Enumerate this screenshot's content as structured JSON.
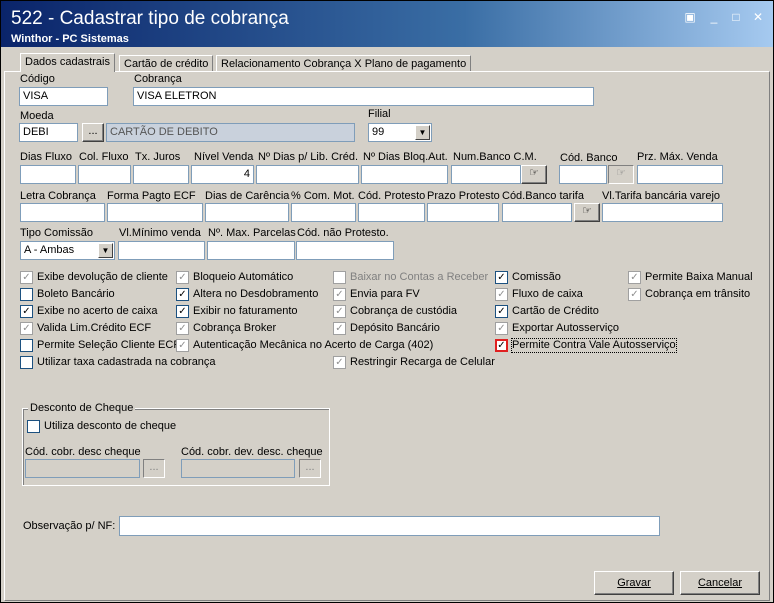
{
  "window": {
    "title": "522 - Cadastrar tipo de cobrança",
    "subtitle": "Winthor - PC Sistemas",
    "controls": [
      "▣",
      "_",
      "□",
      "✕"
    ]
  },
  "tabs": [
    {
      "label": "Dados cadastrais"
    },
    {
      "label": "Cartão de crédito"
    },
    {
      "label": "Relacionamento Cobrança X Plano de pagamento"
    }
  ],
  "fields": {
    "codigo_label": "Código",
    "codigo_value": "VISA",
    "cobranca_label": "Cobrança",
    "cobranca_value": "VISA ELETRON",
    "moeda_label": "Moeda",
    "moeda_value": "DEBI",
    "moeda_desc": "CARTÃO DE DEBITO",
    "filial_label": "Filial",
    "filial_value": "99",
    "lookup_button": "..."
  },
  "row1": {
    "dias_fluxo": "Dias Fluxo",
    "col_fluxo": "Col. Fluxo",
    "tx_juros": "Tx. Juros",
    "nivel_venda": "Nível Venda",
    "nivel_venda_value": "4",
    "dias_lib_cred": "Nº Dias p/ Lib. Créd.",
    "dias_bloq_aut": "Nº Dias Bloq.Aut.",
    "num_banco_cm": "Num.Banco C.M.",
    "cod_banco": "Cód. Banco",
    "prz_max_venda": "Prz. Máx. Venda"
  },
  "row2": {
    "letra_cobranca": "Letra Cobrança",
    "forma_pagto_ecf": "Forma Pagto ECF",
    "dias_carencia": "Dias de Carência",
    "com_mot": "% Com. Mot.",
    "cod_protesto": "Cód. Protesto",
    "prazo_protesto": "Prazo Protesto",
    "cod_banco_tarifa": "Cód.Banco tarifa",
    "vl_tarifa": "Vl.Tarifa bancária varejo"
  },
  "row3": {
    "tipo_comissao": "Tipo Comissão",
    "tipo_comissao_value": "A - Ambas",
    "vl_minimo_venda": "Vl.Mínimo venda",
    "max_parcelas": "Nº. Max. Parcelas",
    "cod_nao_protesto": "Cód. não  Protesto."
  },
  "checkboxes": {
    "col1": [
      {
        "label": "Exibe devolução de cliente",
        "checked": true,
        "disabled": true
      },
      {
        "label": "Boleto Bancário",
        "checked": false,
        "disabled": false
      },
      {
        "label": "Exibe no acerto de caixa",
        "checked": true,
        "disabled": false
      },
      {
        "label": "Valida Lim.Crédito ECF",
        "checked": true,
        "disabled": true
      },
      {
        "label": "Permite Seleção Cliente ECF",
        "checked": false,
        "disabled": false
      },
      {
        "label": "Utilizar taxa cadastrada na cobrança",
        "checked": false,
        "disabled": false
      }
    ],
    "col2": [
      {
        "label": "Bloqueio Automático",
        "checked": true,
        "disabled": true
      },
      {
        "label": "Altera no Desdobramento",
        "checked": true,
        "disabled": false
      },
      {
        "label": "Exibir no faturamento",
        "checked": true,
        "disabled": false
      },
      {
        "label": "Cobrança Broker",
        "checked": true,
        "disabled": true
      },
      {
        "label": "Autenticação Mecânica no Acerto de Carga (402)",
        "checked": true,
        "disabled": true
      }
    ],
    "col3": [
      {
        "label": "Baixar no Contas a Receber",
        "checked": false,
        "disabled": true
      },
      {
        "label": "Envia para FV",
        "checked": true,
        "disabled": true
      },
      {
        "label": "Cobrança de custódia",
        "checked": true,
        "disabled": true
      },
      {
        "label": "Depósito Bancário",
        "checked": true,
        "disabled": true
      },
      {
        "label": "Restringir Recarga de Celular",
        "checked": true,
        "disabled": true
      }
    ],
    "col4": [
      {
        "label": "Comissão",
        "checked": true,
        "disabled": false
      },
      {
        "label": "Fluxo de caixa",
        "checked": true,
        "disabled": true
      },
      {
        "label": "Cartão de Crédito",
        "checked": true,
        "disabled": false
      },
      {
        "label": "Exportar Autosserviço",
        "checked": true,
        "disabled": true
      },
      {
        "label": "Permite Contra Vale Autosserviço",
        "checked": true,
        "disabled": false,
        "highlight": true
      }
    ],
    "col5": [
      {
        "label": "Permite Baixa Manual",
        "checked": true,
        "disabled": true
      },
      {
        "label": "Cobrança em trânsito",
        "checked": true,
        "disabled": true
      }
    ]
  },
  "desconto": {
    "group_title": "Desconto de Cheque",
    "utiliza_label": "Utiliza desconto de cheque",
    "cod_cobr_desc": "Cód. cobr. desc cheque",
    "cod_cobr_dev": "Cód. cobr. dev. desc. cheque"
  },
  "observacao_label": "Observação p/ NF:",
  "buttons": {
    "gravar": "Gravar",
    "cancelar": "Cancelar"
  },
  "colors": {
    "title_start": "#0a246a",
    "title_end": "#a6caf0",
    "face": "#d4d0c8",
    "highlight_border": "#e02020"
  }
}
